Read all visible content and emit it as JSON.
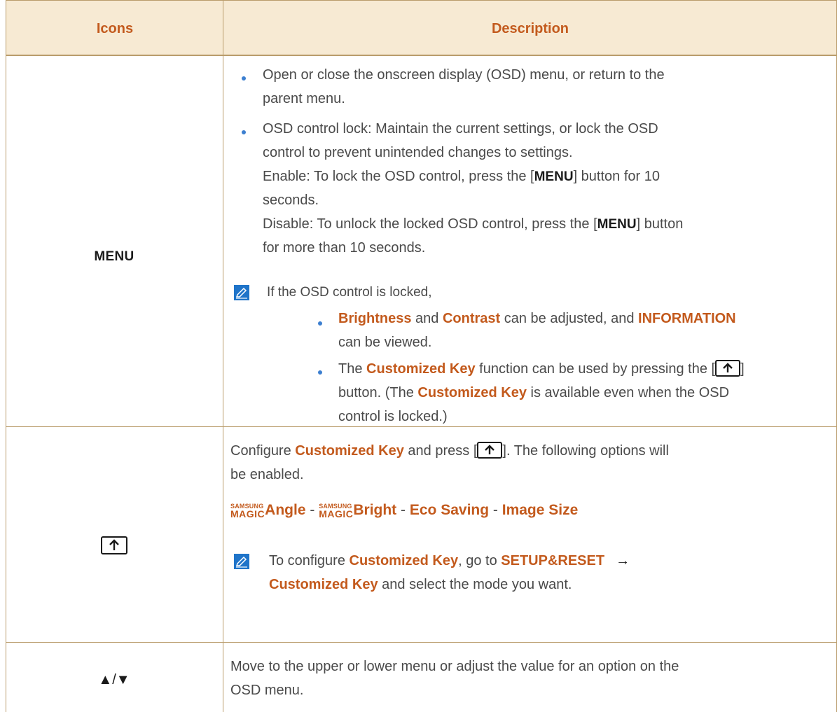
{
  "table": {
    "header": {
      "icons": "Icons",
      "description": "Description"
    },
    "rows": {
      "menu": {
        "icon_label": "MENU",
        "bullet1": {
          "line1": "Open or close the onscreen display (OSD) menu, or return to the",
          "line2": "parent menu."
        },
        "bullet2": {
          "line1": "OSD control lock: Maintain the current settings, or lock the OSD",
          "line2": "control to prevent unintended changes to settings.",
          "line3_a": "Enable: To lock the OSD control, press the [",
          "line3_key": "MENU",
          "line3_b": "] button for 10",
          "line4": "seconds.",
          "line5_a": "Disable: To unlock the locked OSD control, press the [",
          "line5_key": "MENU",
          "line5_b": "] button",
          "line6": "for more than 10 seconds."
        },
        "note": {
          "intro": "If the OSD control is locked,",
          "sub1": {
            "brightness": "Brightness",
            "and": " and ",
            "contrast": "Contrast",
            "mid": " can be adjusted, and ",
            "information": "INFORMATION",
            "line2": "can be viewed."
          },
          "sub2": {
            "a": "The ",
            "ck": "Customized Key",
            "b": " function can be used by pressing the [",
            "c": "]",
            "line2_a": "button. (The ",
            "line2_ck": "Customized Key",
            "line2_b": " is available even when the OSD",
            "line3": "control is locked.)"
          }
        }
      },
      "custom": {
        "line1_a": "Configure ",
        "line1_ck": "Customized Key",
        "line1_b": " and press [",
        "line1_c": "]. The following options will",
        "line2": "be enabled.",
        "magic_small": "SAMSUNG",
        "magic_big": "MAGIC",
        "angle": "Angle",
        "sep": " - ",
        "bright": "Bright",
        "eco": "Eco Saving",
        "image_size": "Image Size",
        "note": {
          "a": "To configure ",
          "ck": "Customized Key",
          "b": ", go to ",
          "setup": "SETUP&RESET",
          "arrow": "→",
          "line2_ck": "Customized Key",
          "line2_b": " and select the mode you want."
        }
      },
      "arrows": {
        "icon_label": "▲/▼",
        "line1": "Move to the upper or lower menu or adjust the value for an option on the",
        "line2": "OSD menu."
      }
    }
  },
  "colors": {
    "accent": "#c35a1d",
    "header_bg": "#f7ead3",
    "border": "#b99c6b",
    "bullet": "#3c7fd0",
    "note_icon": "#1f74c9"
  }
}
